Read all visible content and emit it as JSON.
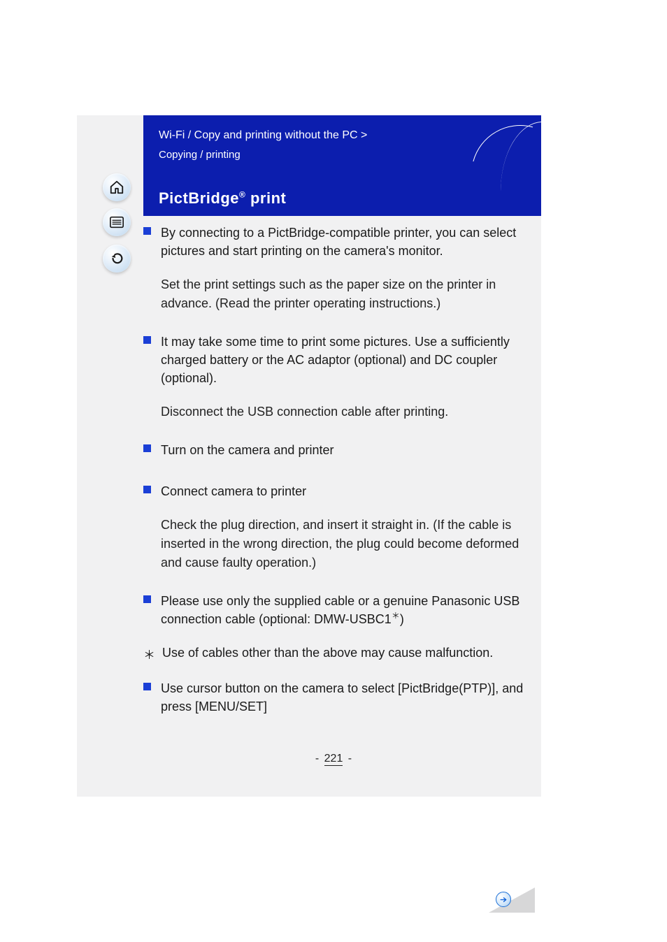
{
  "header": {
    "breadcrumb_prefix": "Wi-Fi / Copy and printing without the PC",
    "breadcrumb_sep": " > ",
    "subnav": "Copying / printing",
    "title_prefix": "PictBridge",
    "title_suffix": " print"
  },
  "items": [
    {
      "title": "By connecting to a PictBridge-compatible printer, you can select pictures and start printing on the camera's monitor.",
      "desc": "Set the print settings such as the paper size on the printer in advance. (Read the printer operating instructions.)"
    },
    {
      "title": "It may take some time to print some pictures. Use a sufficiently charged battery or the AC adaptor (optional) and DC coupler (optional).",
      "desc": "Disconnect the USB connection cable after printing."
    },
    {
      "title": "Turn on the camera and printer",
      "desc": ""
    },
    {
      "title": "Connect camera to printer",
      "desc": "Check the plug direction, and insert it straight in. (If the cable is inserted in the wrong direction, the plug could become deformed and cause faulty operation.)"
    },
    {
      "title_prefix": "Please use only the supplied cable or a genuine Panasonic USB connection cable (optional: DMW-USBC1",
      "title_suffix": ")",
      "desc": ""
    }
  ],
  "footnote": {
    "mark": "＊",
    "text": "Use of cables other than the above may cause malfunction."
  },
  "final_item": {
    "title": "Use cursor button on the camera to select [PictBridge(PTP)], and press [MENU/SET]"
  },
  "page_number": "221",
  "icons": {
    "home": "home-icon",
    "menu": "menu-icon",
    "back": "back-icon",
    "next": "next-arrow-icon"
  }
}
